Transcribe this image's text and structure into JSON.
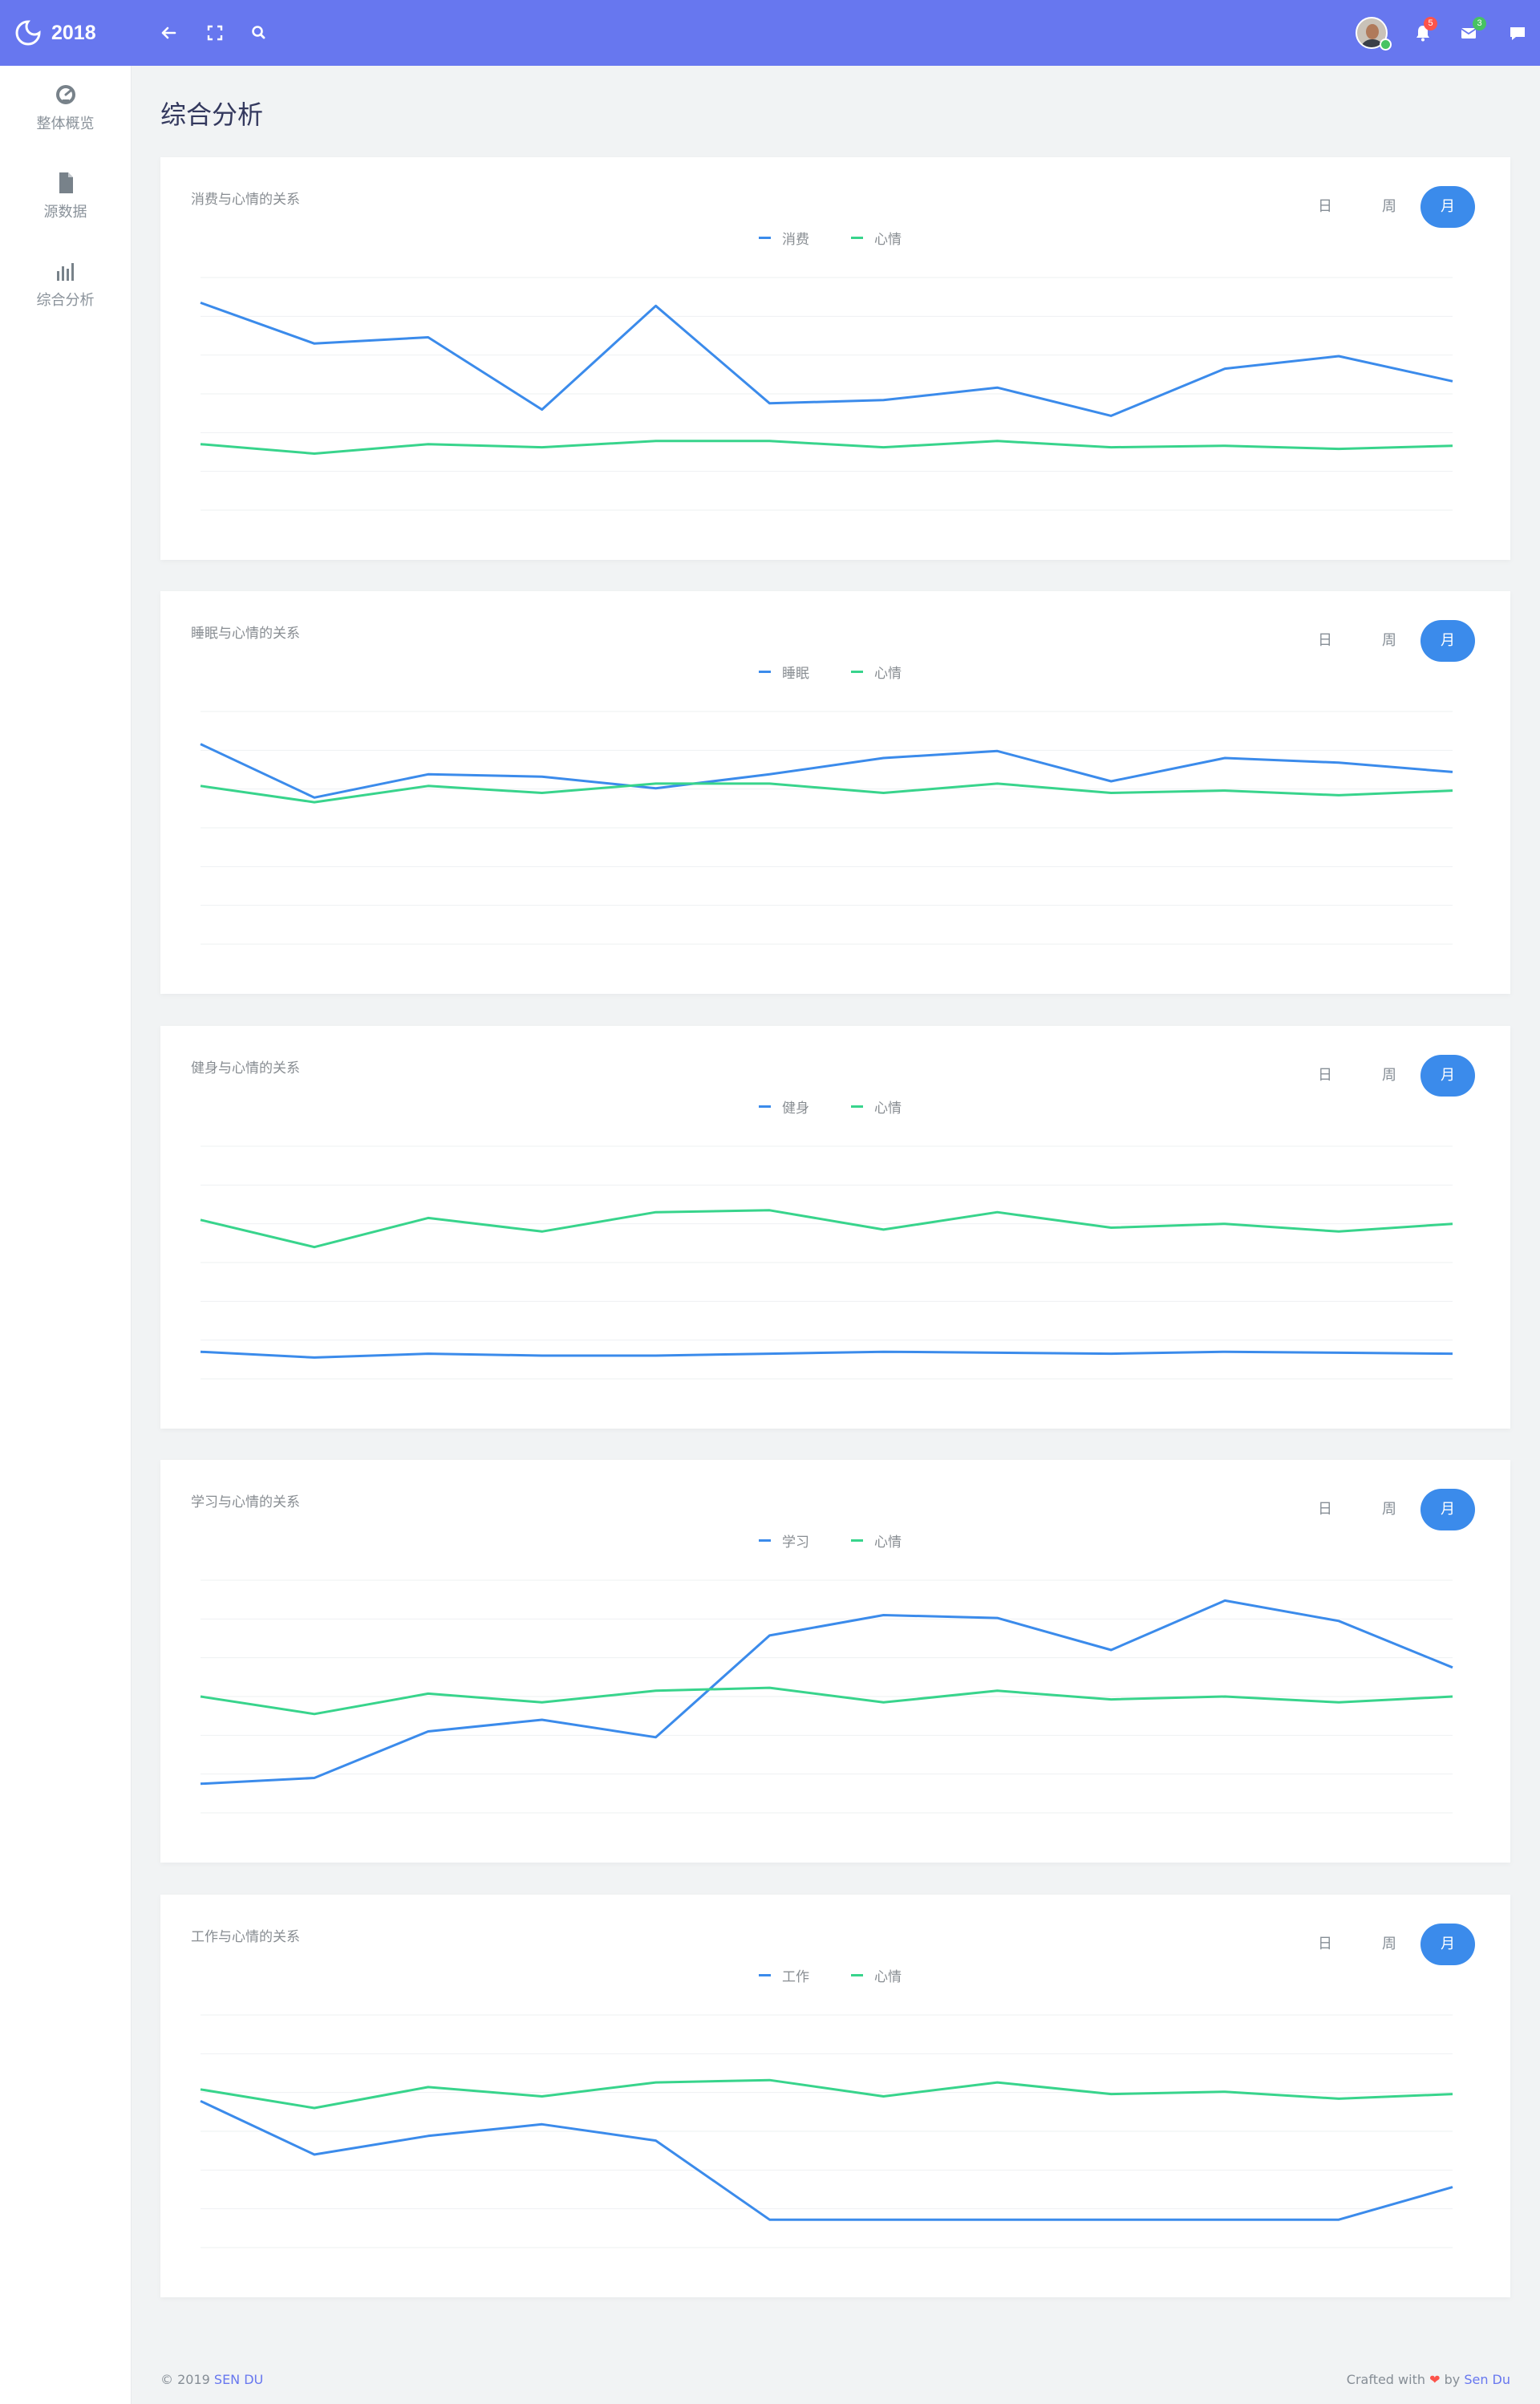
{
  "app": {
    "brand": "2018",
    "colors": {
      "header": "#6777ef",
      "series_primary": "#3b8beb",
      "series_mood": "#38d48c"
    }
  },
  "topbar": {
    "icons": [
      "back-arrow-icon",
      "fullscreen-icon",
      "search-icon"
    ],
    "notifications_count": "5",
    "messages_count": "3"
  },
  "sidebar": {
    "items": [
      {
        "label": "整体概览",
        "icon": "dashboard-icon"
      },
      {
        "label": "源数据",
        "icon": "file-icon"
      },
      {
        "label": "综合分析",
        "icon": "bar-chart-icon"
      }
    ]
  },
  "page": {
    "title": "综合分析"
  },
  "tabs": {
    "day": "日",
    "week": "周",
    "month": "月",
    "active": "月"
  },
  "mood_label": "心情",
  "chart_data": [
    {
      "type": "line",
      "title": "消费与心情的关系",
      "x": [
        1,
        2,
        3,
        4,
        5,
        6,
        7,
        8,
        9,
        10,
        11,
        12
      ],
      "series": [
        {
          "name": "消费",
          "color": "#3b8beb",
          "values": [
            64,
            51,
            53,
            30,
            63,
            32,
            33,
            37,
            28,
            43,
            47,
            39
          ]
        },
        {
          "name": "心情",
          "color": "#38d48c",
          "values": [
            19,
            16,
            19,
            18,
            20,
            20,
            18,
            20,
            18,
            18.5,
            17.5,
            18.5
          ]
        }
      ],
      "ylim": [
        -2,
        72
      ]
    },
    {
      "type": "line",
      "title": "睡眠与心情的关系",
      "x": [
        1,
        2,
        3,
        4,
        5,
        6,
        7,
        8,
        9,
        10,
        11,
        12
      ],
      "series": [
        {
          "name": "睡眠",
          "color": "#3b8beb",
          "values": [
            8.6,
            6.3,
            7.3,
            7.2,
            6.7,
            7.3,
            8.0,
            8.3,
            7.0,
            8.0,
            7.8,
            7.4
          ]
        },
        {
          "name": "心情",
          "color": "#38d48c",
          "values": [
            6.8,
            6.1,
            6.8,
            6.5,
            6.9,
            6.9,
            6.5,
            6.9,
            6.5,
            6.6,
            6.4,
            6.6
          ]
        }
      ],
      "ylim": [
        0,
        10
      ]
    },
    {
      "type": "line",
      "title": "健身与心情的关系",
      "x": [
        1,
        2,
        3,
        4,
        5,
        6,
        7,
        8,
        9,
        10,
        11,
        12
      ],
      "series": [
        {
          "name": "健身",
          "color": "#3b8beb",
          "values": [
            1.4,
            1.1,
            1.3,
            1.2,
            1.2,
            1.3,
            1.4,
            1.35,
            1.3,
            1.4,
            1.35,
            1.3
          ]
        },
        {
          "name": "心情",
          "color": "#38d48c",
          "values": [
            8.2,
            6.8,
            8.3,
            7.6,
            8.6,
            8.7,
            7.7,
            8.6,
            7.8,
            8.0,
            7.6,
            8.0
          ]
        }
      ],
      "ylim": [
        0,
        12
      ]
    },
    {
      "type": "line",
      "title": "学习与心情的关系",
      "x": [
        1,
        2,
        3,
        4,
        5,
        6,
        7,
        8,
        9,
        10,
        11,
        12
      ],
      "series": [
        {
          "name": "学习",
          "color": "#3b8beb",
          "values": [
            1,
            1.2,
            2.8,
            3.2,
            2.6,
            6.1,
            6.8,
            6.7,
            5.6,
            7.3,
            6.6,
            5.0
          ]
        },
        {
          "name": "心情",
          "color": "#38d48c",
          "values": [
            4.0,
            3.4,
            4.1,
            3.8,
            4.2,
            4.3,
            3.8,
            4.2,
            3.9,
            4.0,
            3.8,
            4.0
          ]
        }
      ],
      "ylim": [
        0,
        8
      ]
    },
    {
      "type": "line",
      "title": "工作与心情的关系",
      "x": [
        1,
        2,
        3,
        4,
        5,
        6,
        7,
        8,
        9,
        10,
        11,
        12
      ],
      "series": [
        {
          "name": "工作",
          "color": "#3b8beb",
          "values": [
            6.3,
            4.0,
            4.8,
            5.3,
            4.6,
            1.2,
            1.2,
            1.2,
            1.2,
            1.2,
            1.2,
            2.6
          ]
        },
        {
          "name": "心情",
          "color": "#38d48c",
          "values": [
            6.8,
            6.0,
            6.9,
            6.5,
            7.1,
            7.2,
            6.5,
            7.1,
            6.6,
            6.7,
            6.4,
            6.6
          ]
        }
      ],
      "ylim": [
        0,
        10
      ]
    }
  ],
  "footer": {
    "copyright": "© 2019",
    "author": "SEN DU",
    "crafted": "Crafted with",
    "by": "by",
    "signature": "Sen Du"
  }
}
